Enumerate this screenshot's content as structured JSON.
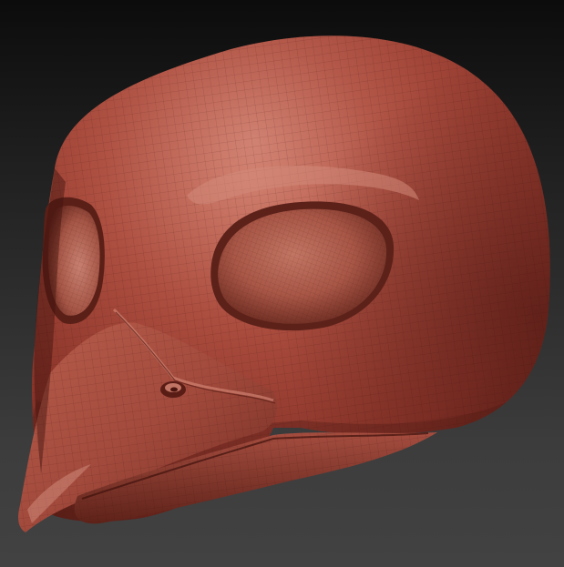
{
  "viewport": {
    "background_top": "#0c0c0c",
    "background_bottom": "#424242"
  },
  "model": {
    "material_color": "#a0463a",
    "highlight_color": "#d07f70",
    "shadow_color": "#4a1a14",
    "wireframe_visible": true
  }
}
